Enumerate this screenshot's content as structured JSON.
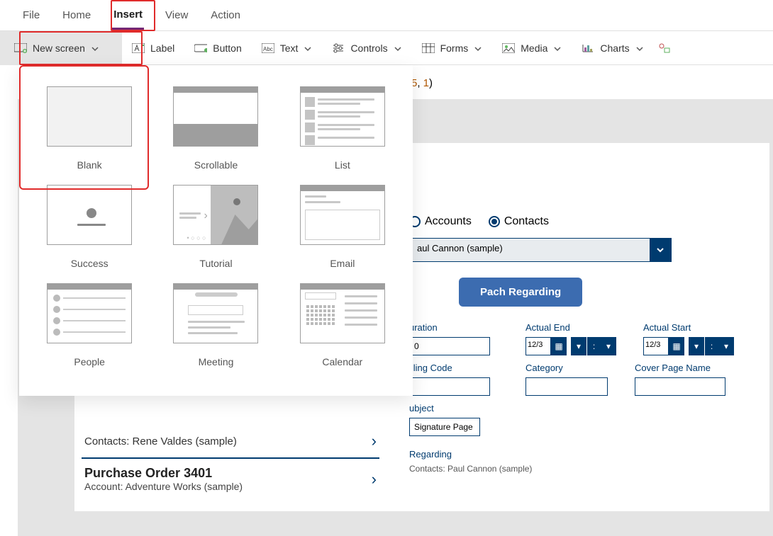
{
  "tabs": {
    "file": "File",
    "home": "Home",
    "insert": "Insert",
    "view": "View",
    "action": "Action"
  },
  "ribbon": {
    "new_screen": "New screen",
    "label": "Label",
    "button": "Button",
    "text": "Text",
    "controls": "Controls",
    "forms": "Forms",
    "media": "Media",
    "charts": "Charts"
  },
  "formula_fragment": {
    "n1": "5",
    "comma": ", ",
    "n2": "1",
    "close": ")"
  },
  "screen_templates": {
    "blank": "Blank",
    "scrollable": "Scrollable",
    "list": "List",
    "success": "Success",
    "tutorial": "Tutorial",
    "email": "Email",
    "people": "People",
    "meeting": "Meeting",
    "calendar": "Calendar"
  },
  "radios": {
    "accounts": "Accounts",
    "contacts": "Contacts"
  },
  "dropdown_value": "aul Cannon (sample)",
  "primary_button": "Pach Regarding",
  "fields": {
    "duration": {
      "label": "uration",
      "value": "0"
    },
    "actual_end": {
      "label": "Actual End",
      "date": "12/3"
    },
    "steppers_colon": ":",
    "actual_start": {
      "label": "Actual Start",
      "date": "12/3"
    },
    "billing_code": {
      "label": "illing Code"
    },
    "category": {
      "label": "Category"
    },
    "cover_page": {
      "label": "Cover Page Name"
    },
    "subject": {
      "label": "ubject",
      "value": "Signature Page"
    },
    "regarding": {
      "label": "Regarding",
      "value": "Contacts: Paul Cannon (sample)"
    }
  },
  "list_rows": {
    "r1": "Contacts: Rene Valdes (sample)",
    "r2_title": "Purchase Order 3401",
    "r2_sub": "Account: Adventure Works (sample)"
  }
}
